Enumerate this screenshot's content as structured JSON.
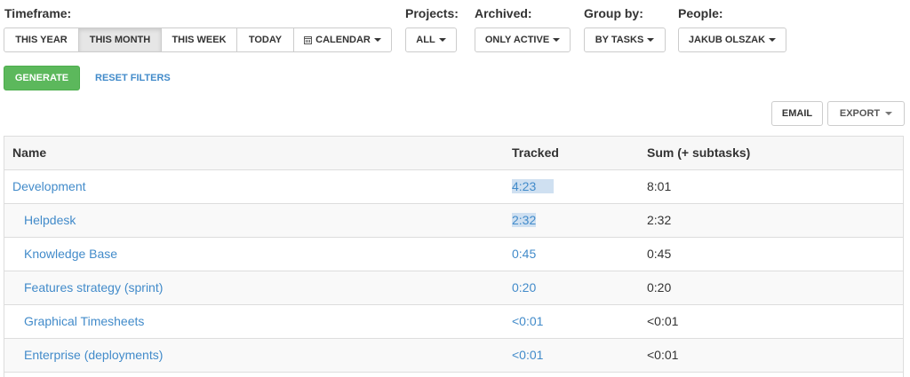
{
  "filters": {
    "timeframe": {
      "label": "Timeframe:",
      "options": [
        "THIS YEAR",
        "THIS MONTH",
        "THIS WEEK",
        "TODAY",
        "CALENDAR"
      ],
      "selected": "THIS MONTH"
    },
    "projects": {
      "label": "Projects:",
      "value": "ALL"
    },
    "archived": {
      "label": "Archived:",
      "value": "ONLY ACTIVE"
    },
    "group_by": {
      "label": "Group by:",
      "value": "BY TASKS"
    },
    "people": {
      "label": "People:",
      "value": "JAKUB OLSZAK"
    }
  },
  "actions": {
    "generate": "GENERATE",
    "reset": "RESET FILTERS",
    "email": "EMAIL",
    "export": "EXPORT"
  },
  "table": {
    "columns": [
      "Name",
      "Tracked",
      "Sum (+ subtasks)"
    ],
    "rows": [
      {
        "name": "Development",
        "tracked": "4:23",
        "sum": "8:01"
      },
      {
        "name": "Helpdesk",
        "tracked": "2:32",
        "sum": "2:32"
      },
      {
        "name": "Knowledge Base",
        "tracked": "0:45",
        "sum": "0:45"
      },
      {
        "name": "Features strategy (sprint)",
        "tracked": "0:20",
        "sum": "0:20"
      },
      {
        "name": "Graphical Timesheets",
        "tracked": "<0:01",
        "sum": "<0:01"
      },
      {
        "name": "Enterprise (deployments)",
        "tracked": "<0:01",
        "sum": "<0:01"
      }
    ]
  },
  "colors": {
    "link": "#428bca",
    "generate_bg": "#5cb85c",
    "active_btn": "#e6e6e6"
  },
  "icons": {
    "calendar": "calendar-icon",
    "caret": "caret-down-icon"
  }
}
